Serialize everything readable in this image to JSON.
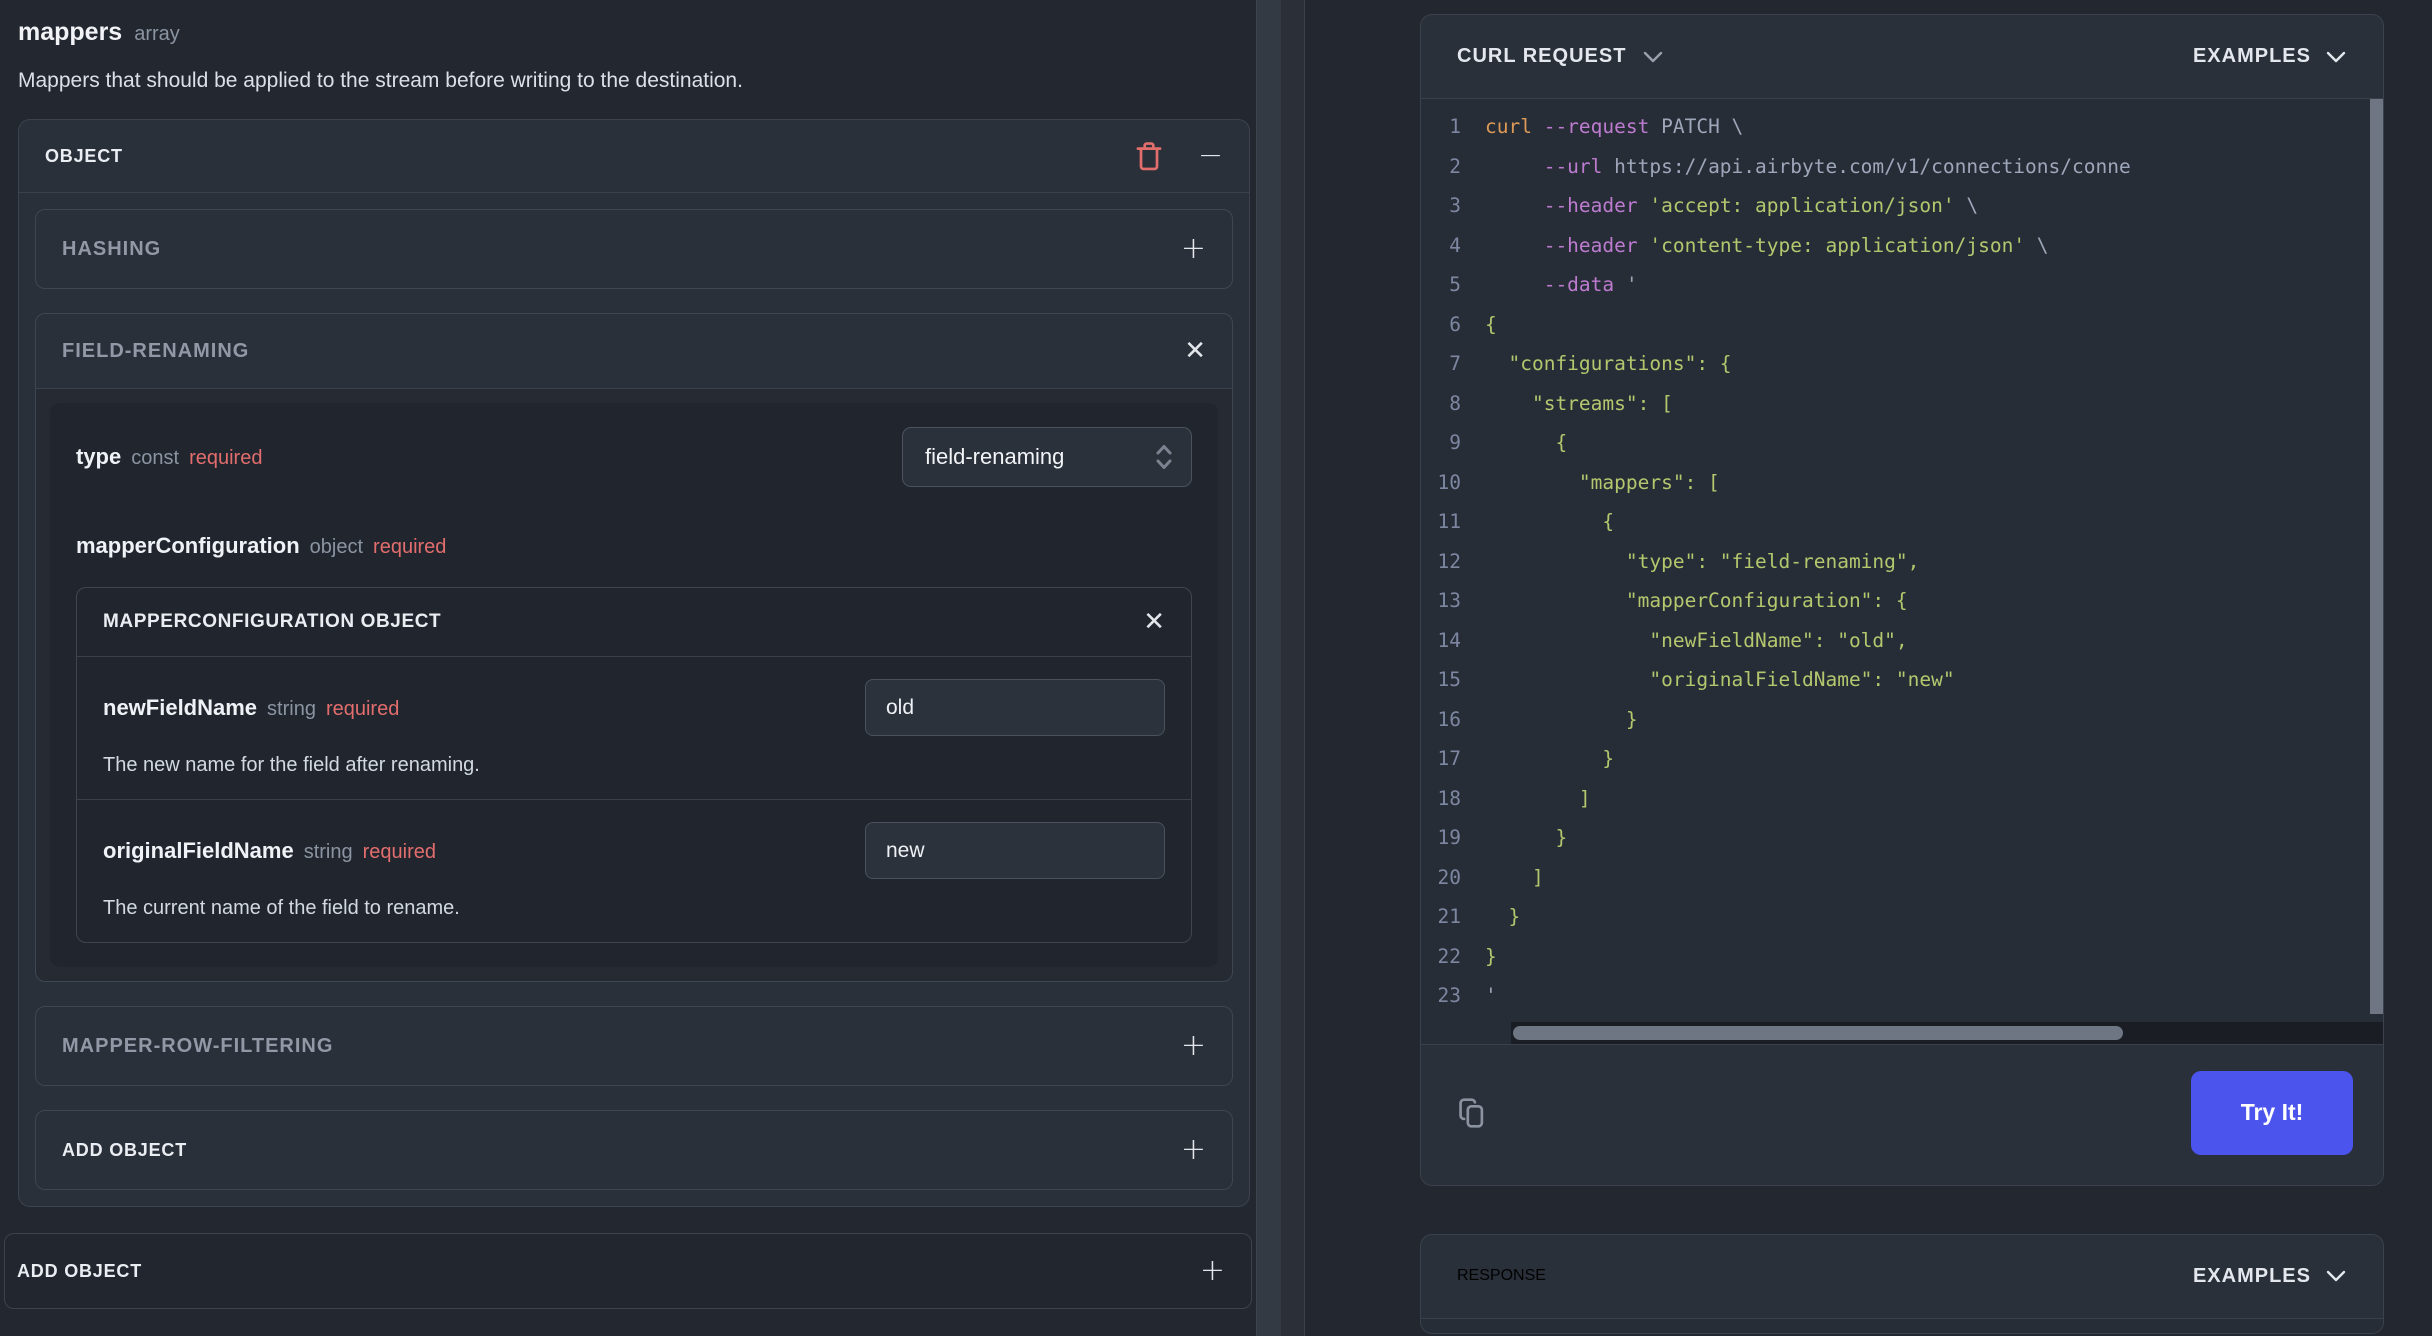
{
  "left": {
    "field_name": "mappers",
    "field_type": "array",
    "description": "Mappers that should be applied to the stream before writing to the destination.",
    "object_card": {
      "title": "OBJECT",
      "hashing_title": "HASHING",
      "field_renaming": {
        "title": "FIELD-RENAMING",
        "type_field": {
          "name": "type",
          "kind": "const",
          "required": "required",
          "value": "field-renaming"
        },
        "mapper_config": {
          "name": "mapperConfiguration",
          "kind": "object",
          "required": "required",
          "card_title": "MAPPERCONFIGURATION OBJECT",
          "fields": [
            {
              "name": "newFieldName",
              "kind": "string",
              "required": "required",
              "value": "old",
              "description": "The new name for the field after renaming."
            },
            {
              "name": "originalFieldName",
              "kind": "string",
              "required": "required",
              "value": "new",
              "description": "The current name of the field to rename."
            }
          ]
        }
      },
      "row_filtering_title": "MAPPER-ROW-FILTERING",
      "add_object_title": "ADD OBJECT"
    },
    "outer_add_object_title": "ADD OBJECT"
  },
  "right": {
    "curl_panel": {
      "title": "CURL REQUEST",
      "examples_label": "EXAMPLES",
      "try_button_label": "Try It!",
      "code_lines": [
        [
          [
            "cmd",
            "curl "
          ],
          [
            "flag",
            "--request"
          ],
          [
            "arg",
            " PATCH \\"
          ]
        ],
        [
          [
            "plain",
            "     "
          ],
          [
            "flag",
            "--url"
          ],
          [
            "arg",
            " https://api.airbyte.com/v1/connections/conne"
          ]
        ],
        [
          [
            "plain",
            "     "
          ],
          [
            "flag",
            "--header"
          ],
          [
            "plain",
            " "
          ],
          [
            "str",
            "'accept: application/json'"
          ],
          [
            "arg",
            " \\"
          ]
        ],
        [
          [
            "plain",
            "     "
          ],
          [
            "flag",
            "--header"
          ],
          [
            "plain",
            " "
          ],
          [
            "str",
            "'content-type: application/json'"
          ],
          [
            "arg",
            " \\"
          ]
        ],
        [
          [
            "plain",
            "     "
          ],
          [
            "flag",
            "--data"
          ],
          [
            "arg",
            " '"
          ]
        ],
        [
          [
            "json",
            "{"
          ]
        ],
        [
          [
            "json",
            "  \"configurations\": {"
          ]
        ],
        [
          [
            "json",
            "    \"streams\": ["
          ]
        ],
        [
          [
            "json",
            "      {"
          ]
        ],
        [
          [
            "json",
            "        \"mappers\": ["
          ]
        ],
        [
          [
            "json",
            "          {"
          ]
        ],
        [
          [
            "json",
            "            \"type\": \"field-renaming\","
          ]
        ],
        [
          [
            "json",
            "            \"mapperConfiguration\": {"
          ]
        ],
        [
          [
            "json",
            "              \"newFieldName\": \"old\","
          ]
        ],
        [
          [
            "json",
            "              \"originalFieldName\": \"new\""
          ]
        ],
        [
          [
            "json",
            "            }"
          ]
        ],
        [
          [
            "json",
            "          }"
          ]
        ],
        [
          [
            "json",
            "        ]"
          ]
        ],
        [
          [
            "json",
            "      }"
          ]
        ],
        [
          [
            "json",
            "    ]"
          ]
        ],
        [
          [
            "json",
            "  }"
          ]
        ],
        [
          [
            "json",
            "}"
          ]
        ],
        [
          [
            "arg",
            "'"
          ]
        ]
      ]
    },
    "response_panel": {
      "title": "RESPONSE",
      "examples_label": "EXAMPLES"
    }
  },
  "colors": {
    "accent_button": "#4b54ec",
    "required_red": "#e26d6d",
    "code_string_green": "#b4c76e",
    "code_flag_purple": "#bd7bd0",
    "code_cmd_orange": "#dd9a57"
  }
}
